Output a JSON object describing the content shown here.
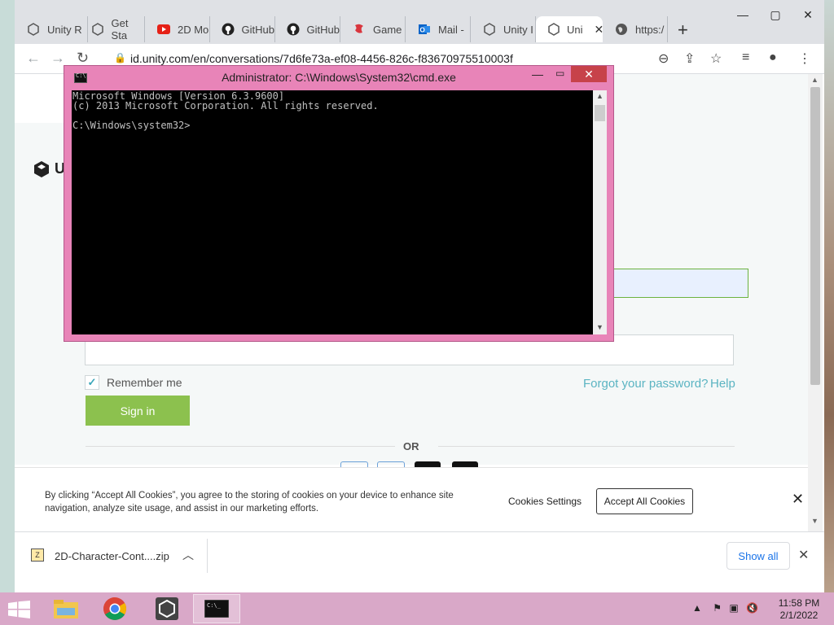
{
  "browser": {
    "tabs": [
      {
        "label": "Unity R",
        "icon": "unity-icon"
      },
      {
        "label": "Get Sta",
        "icon": "unity-icon"
      },
      {
        "label": "2D Mo",
        "icon": "youtube-icon"
      },
      {
        "label": "GitHub",
        "icon": "github-icon"
      },
      {
        "label": "GitHub",
        "icon": "github-icon"
      },
      {
        "label": "Game",
        "icon": "game-icon"
      },
      {
        "label": "Mail -",
        "icon": "outlook-icon"
      },
      {
        "label": "Unity I",
        "icon": "unity-icon"
      },
      {
        "label": "Uni",
        "icon": "unity-icon",
        "active": true
      },
      {
        "label": "https:/",
        "icon": "globe-icon"
      }
    ],
    "url": "id.unity.com/en/conversations/7d6fe73a-ef08-4456-826c-f83670975510003f"
  },
  "login": {
    "remember_label": "Remember me",
    "forgot_label": "Forgot your password?",
    "help_label": "Help",
    "signin_label": "Sign in",
    "or_label": "OR",
    "logo_text": "U"
  },
  "cookie": {
    "text": "By clicking “Accept All Cookies”, you agree to the storing of cookies on your device to enhance site navigation, analyze site usage, and assist in our marketing efforts.",
    "settings_label": "Cookies Settings",
    "accept_label": "Accept All Cookies"
  },
  "download": {
    "filename": "2D-Character-Cont....zip",
    "show_all_label": "Show all"
  },
  "cmd": {
    "title": "Administrator: C:\\Windows\\System32\\cmd.exe",
    "text": "Microsoft Windows [Version 6.3.9600]\n(c) 2013 Microsoft Corporation. All rights reserved.\n\nC:\\Windows\\system32>"
  },
  "taskbar": {
    "time": "11:58 PM",
    "date": "2/1/2022"
  },
  "colors": {
    "cmd_frame": "#e884b8",
    "taskbar": "#d9a8c8",
    "signin": "#8cc14e",
    "link": "#5bb4c2"
  }
}
